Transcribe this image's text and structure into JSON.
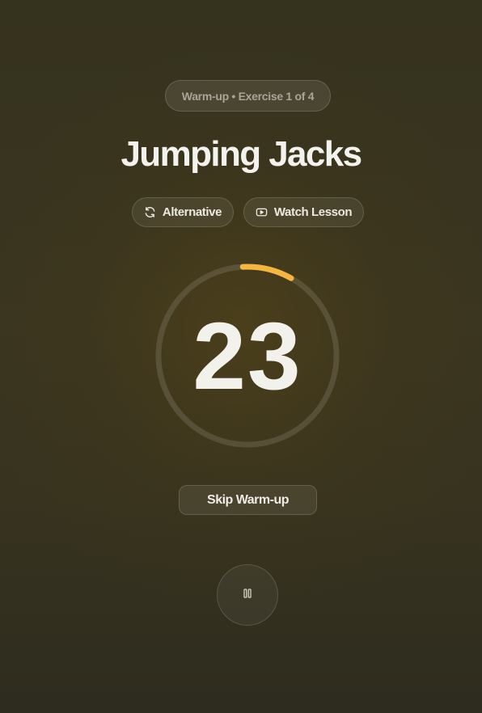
{
  "header": {
    "badge_text": "Warm-up • Exercise 1 of 4",
    "exercise_title": "Jumping Jacks"
  },
  "actions": {
    "alternative_label": "Alternative",
    "alternative_icon": "refresh-icon",
    "watch_label": "Watch Lesson",
    "watch_icon": "play-video-icon"
  },
  "timer": {
    "seconds_remaining": "23",
    "progress_fraction": 0.09,
    "ring_color": "#f4b63f",
    "track_color": "rgba(255,255,255,0.12)"
  },
  "controls": {
    "skip_label": "Skip Warm-up",
    "pause_icon": "pause-icon"
  },
  "colors": {
    "accent": "#f4b63f"
  }
}
